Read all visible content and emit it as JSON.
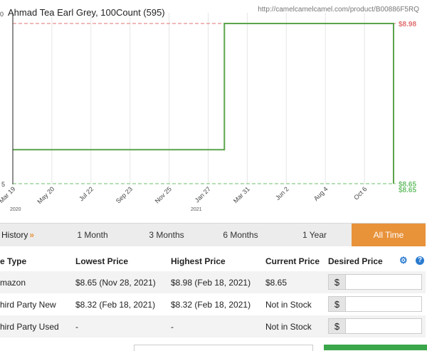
{
  "product": {
    "title": "Ahmad Tea Earl Grey, 100Count (595)",
    "url": "http://camelcamelcamel.com/product/B00886F5RQ"
  },
  "chart_data": {
    "type": "line",
    "title": "Ahmad Tea Earl Grey, 100Count (595)",
    "x_tick_labels": [
      "Mar 19",
      "May 20",
      "Jul 22",
      "Sep 23",
      "Nov 25",
      "Jan 27",
      "Mar 31",
      "Jun 2",
      "Aug 4",
      "Oct 6"
    ],
    "year_labels": [
      "2020",
      "2021"
    ],
    "y_tick_labels": [
      "0",
      "5"
    ],
    "ylim": [
      8.65,
      8.98
    ],
    "reference_lines": [
      {
        "label": "$8.98",
        "value": 8.98,
        "color": "#e07070"
      },
      {
        "label": "$8.65",
        "value": 8.65,
        "color": "#6cc06c"
      },
      {
        "label": "$8.65",
        "value": 8.65,
        "color": "#6cc06c"
      }
    ],
    "series": [
      {
        "color": "#5aa34a",
        "points": [
          {
            "x": "2020-03",
            "y": 8.72
          },
          {
            "x": "2021-02-18",
            "y": 8.72
          },
          {
            "x": "2021-02-18",
            "y": 8.98
          },
          {
            "x": "2021-11-28",
            "y": 8.98
          },
          {
            "x": "2021-11-28",
            "y": 8.65
          }
        ]
      }
    ],
    "grid": true
  },
  "tabs": [
    {
      "label": "History",
      "arrow": "»"
    },
    {
      "label": "1 Month"
    },
    {
      "label": "3 Months"
    },
    {
      "label": "6 Months"
    },
    {
      "label": "1 Year"
    },
    {
      "label": "All Time",
      "active": true
    }
  ],
  "table": {
    "headers": [
      "e Type",
      "Lowest Price",
      "Highest Price",
      "Current Price",
      "Desired Price"
    ],
    "rows": [
      {
        "type": "mazon",
        "lowest": "$8.65 (Nov 28, 2021)",
        "highest": "$8.98 (Feb 18, 2021)",
        "current": "$8.65",
        "currency": "$"
      },
      {
        "type": "hird Party New",
        "lowest": "$8.32 (Feb 18, 2021)",
        "highest": "$8.32 (Feb 18, 2021)",
        "current": "Not in Stock",
        "currency": "$"
      },
      {
        "type": "hird Party Used",
        "lowest": "-",
        "highest": "-",
        "current": "Not in Stock",
        "currency": "$"
      }
    ]
  },
  "icons": {
    "settings": "gear-icon",
    "help": "help-icon",
    "help_glyph": "?",
    "settings_glyph": "⚙"
  }
}
